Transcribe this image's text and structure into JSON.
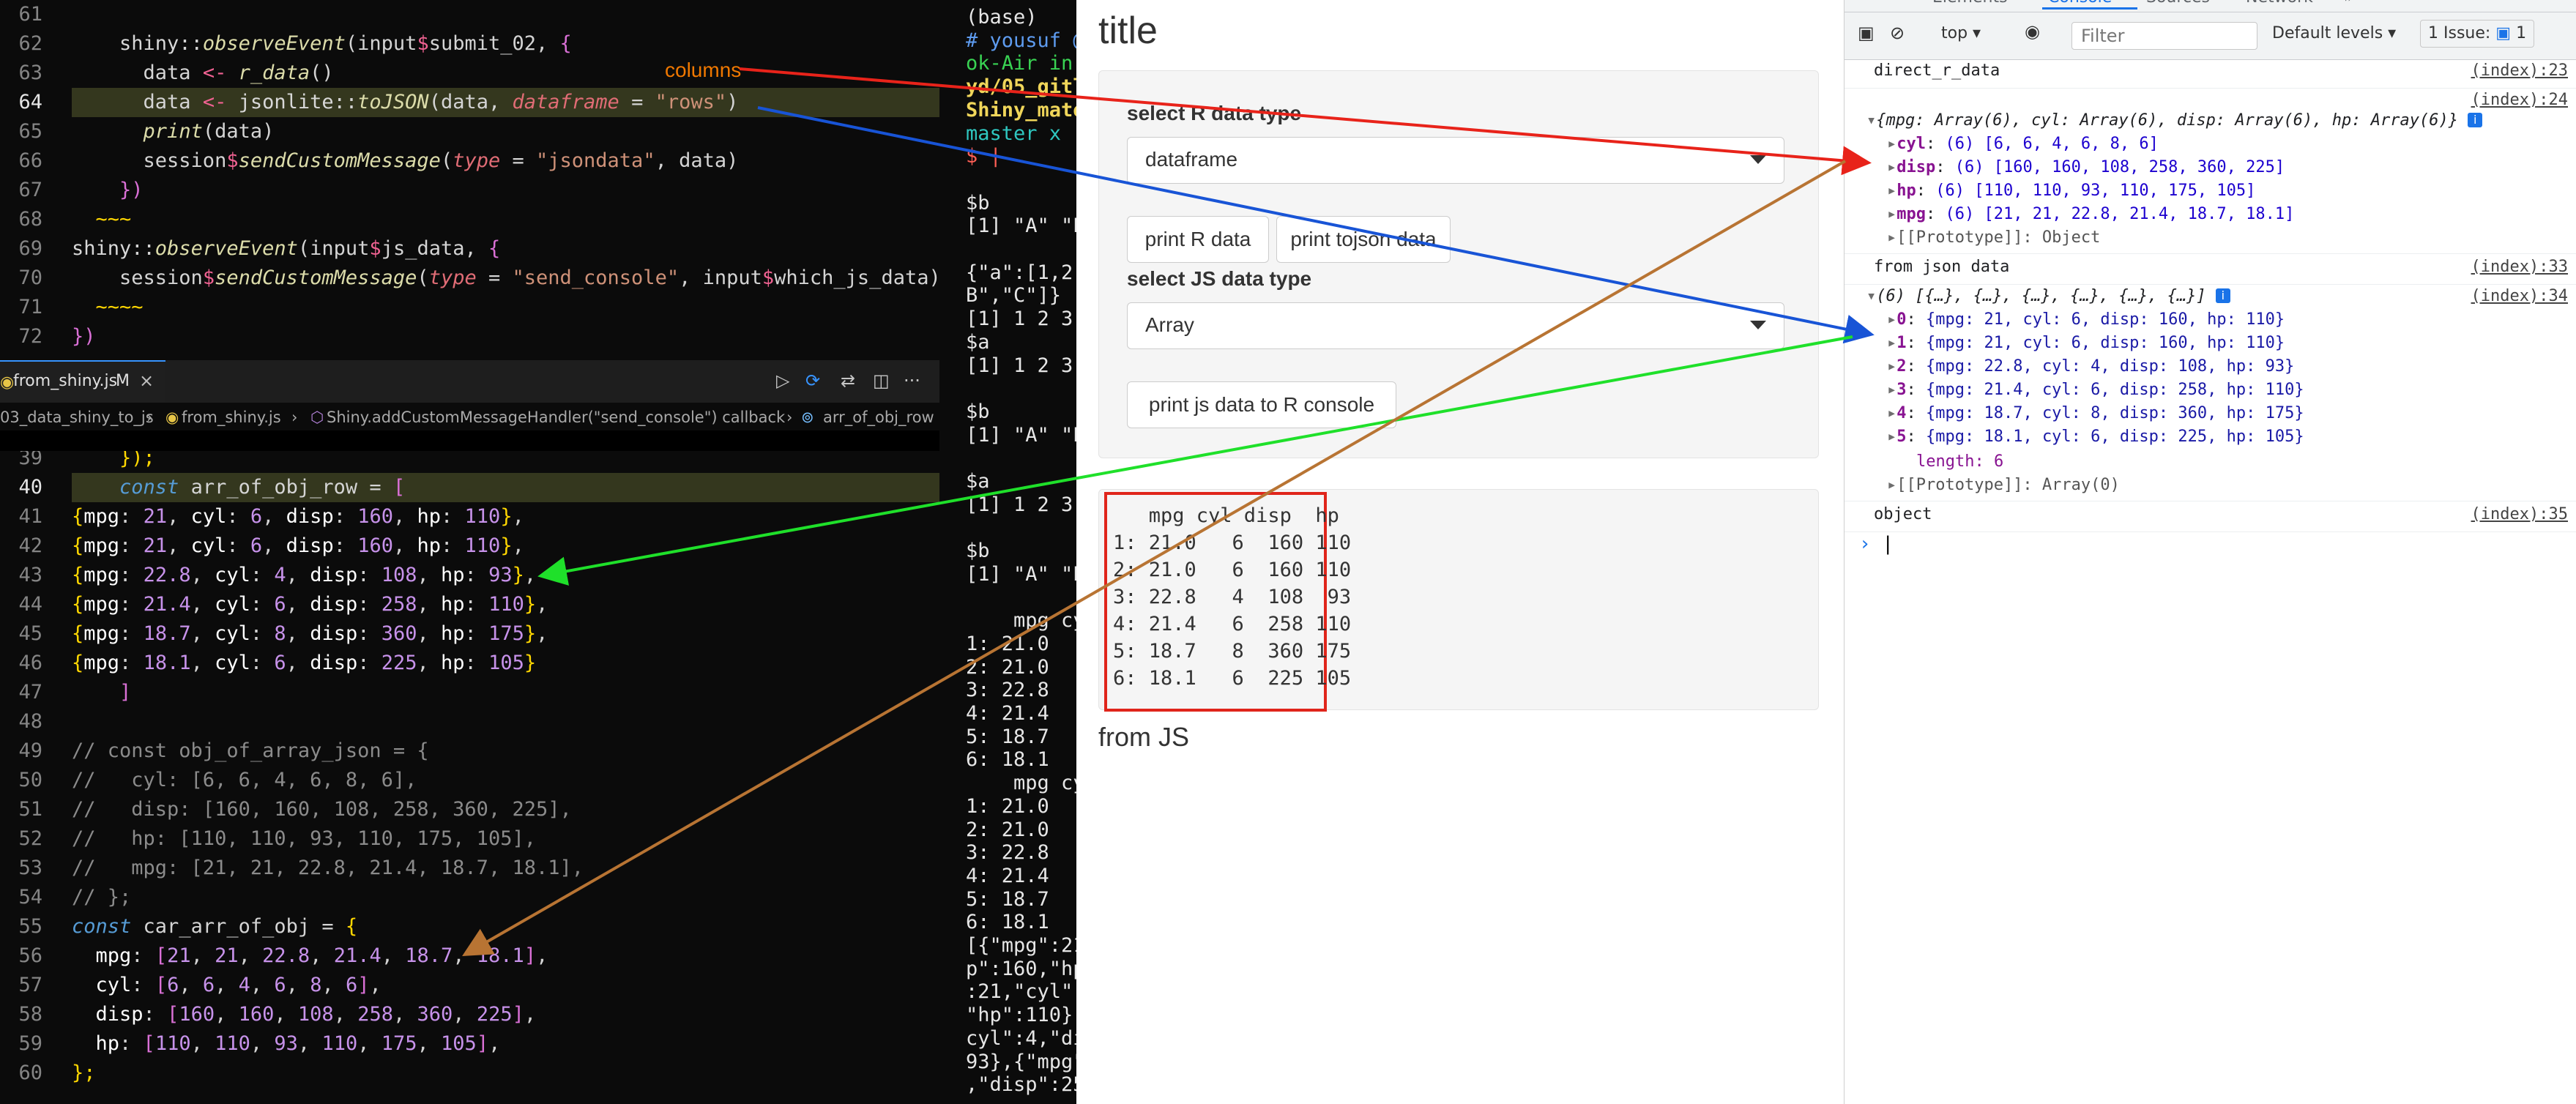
{
  "editor_top": {
    "lines": [
      {
        "num": "61",
        "html": ""
      },
      {
        "num": "62",
        "html": "    <span class='t-ns'>shiny</span><span class='t-var'>::</span><span class='t-fn'>observeEvent</span><span class='t-var'>(input</span><span class='t-dollar'>$</span><span class='t-var'>submit_02, </span><span class='t-brace2'>{</span>"
      },
      {
        "num": "63",
        "html": "      data <span class='t-op'>&lt;-</span> <span class='t-fn'>r_data</span>()"
      },
      {
        "num": "64",
        "html": "      data <span class='t-op'>&lt;-</span> <span class='t-ns'>jsonlite</span>::<span class='t-fn'>toJSON</span>(data, <span class='t-param'>dataframe</span> = <span class='t-str'>\"rows\"</span>)",
        "current": true
      },
      {
        "num": "65",
        "html": "      <span class='t-fn'>print</span>(data)"
      },
      {
        "num": "66",
        "html": "      session<span class='t-dollar'>$</span><span class='t-fn'>sendCustomMessage</span>(<span class='t-param'>type</span> = <span class='t-str'>\"jsondata\"</span>, data)"
      },
      {
        "num": "67",
        "html": "    <span class='t-brace2'>})</span>"
      },
      {
        "num": "68",
        "html": "  <span class='t-brace'>~~~</span>"
      },
      {
        "num": "69",
        "html": "<span class='t-ns'>shiny</span>::<span class='t-fn'>observeEvent</span>(input<span class='t-dollar'>$</span><span class='t-var'>js_data, </span><span class='t-brace2'>{</span>"
      },
      {
        "num": "70",
        "html": "    session<span class='t-dollar'>$</span><span class='t-fn'>sendCustomMessage</span>(<span class='t-param'>type</span> = <span class='t-str'>\"send_console\"</span>, input<span class='t-dollar'>$</span>which_js_data)"
      },
      {
        "num": "71",
        "html": "  <span class='t-brace'>~~~~</span>"
      },
      {
        "num": "72",
        "html": "<span class='t-brace2'>})</span>"
      }
    ]
  },
  "tabbar": {
    "file_name": "from_shiny.js",
    "modified": "M",
    "breadcrumb_1": "03_data_shiny_to_js",
    "breadcrumb_2": "from_shiny.js",
    "breadcrumb_3": "Shiny.addCustomMessageHandler(\"send_console\") callback",
    "breadcrumb_4": "arr_of_obj_row"
  },
  "editor_bottom": {
    "lines": [
      {
        "num": "39",
        "html": "    <span class='t-brace'>});</span>"
      },
      {
        "num": "40",
        "html": "    <span class='t-const'>const</span> <span class='t-var'>arr_of_obj_row</span> = <span class='t-brace2'>[</span>",
        "current": true
      },
      {
        "num": "41",
        "html": "<span class='t-brace'>{</span><span class='t-prop'>mpg</span>: <span class='t-num'>21</span>, <span class='t-prop'>cyl</span>: <span class='t-num'>6</span>, <span class='t-prop'>disp</span>: <span class='t-num'>160</span>, <span class='t-prop'>hp</span>: <span class='t-num'>110</span><span class='t-brace'>}</span>,"
      },
      {
        "num": "42",
        "html": "<span class='t-brace'>{</span><span class='t-prop'>mpg</span>: <span class='t-num'>21</span>, <span class='t-prop'>cyl</span>: <span class='t-num'>6</span>, <span class='t-prop'>disp</span>: <span class='t-num'>160</span>, <span class='t-prop'>hp</span>: <span class='t-num'>110</span><span class='t-brace'>}</span>,"
      },
      {
        "num": "43",
        "html": "<span class='t-brace'>{</span><span class='t-prop'>mpg</span>: <span class='t-num'>22.8</span>, <span class='t-prop'>cyl</span>: <span class='t-num'>4</span>, <span class='t-prop'>disp</span>: <span class='t-num'>108</span>, <span class='t-prop'>hp</span>: <span class='t-num'>93</span><span class='t-brace'>}</span>,"
      },
      {
        "num": "44",
        "html": "<span class='t-brace'>{</span><span class='t-prop'>mpg</span>: <span class='t-num'>21.4</span>, <span class='t-prop'>cyl</span>: <span class='t-num'>6</span>, <span class='t-prop'>disp</span>: <span class='t-num'>258</span>, <span class='t-prop'>hp</span>: <span class='t-num'>110</span><span class='t-brace'>}</span>,"
      },
      {
        "num": "45",
        "html": "<span class='t-brace'>{</span><span class='t-prop'>mpg</span>: <span class='t-num'>18.7</span>, <span class='t-prop'>cyl</span>: <span class='t-num'>8</span>, <span class='t-prop'>disp</span>: <span class='t-num'>360</span>, <span class='t-prop'>hp</span>: <span class='t-num'>175</span><span class='t-brace'>}</span>,"
      },
      {
        "num": "46",
        "html": "<span class='t-brace'>{</span><span class='t-prop'>mpg</span>: <span class='t-num'>18.1</span>, <span class='t-prop'>cyl</span>: <span class='t-num'>6</span>, <span class='t-prop'>disp</span>: <span class='t-num'>225</span>, <span class='t-prop'>hp</span>: <span class='t-num'>105</span><span class='t-brace'>}</span>"
      },
      {
        "num": "47",
        "html": "    <span class='t-brace2'>]</span>"
      },
      {
        "num": "48",
        "html": ""
      },
      {
        "num": "49",
        "html": "<span class='t-cmt2'>// const obj_of_array_json = {</span>"
      },
      {
        "num": "50",
        "html": "<span class='t-cmt2'>//   cyl: [6, 6, 4, 6, 8, 6],</span>"
      },
      {
        "num": "51",
        "html": "<span class='t-cmt2'>//   disp: [160, 160, 108, 258, 360, 225],</span>"
      },
      {
        "num": "52",
        "html": "<span class='t-cmt2'>//   hp: [110, 110, 93, 110, 175, 105],</span>"
      },
      {
        "num": "53",
        "html": "<span class='t-cmt2'>//   mpg: [21, 21, 22.8, 21.4, 18.7, 18.1],</span>"
      },
      {
        "num": "54",
        "html": "<span class='t-cmt2'>// };</span>"
      },
      {
        "num": "55",
        "html": "<span class='t-const'>const</span> <span class='t-var'>car_arr_of_obj</span> = <span class='t-brace'>{</span>"
      },
      {
        "num": "56",
        "html": "  <span class='t-prop'>mpg</span>: <span class='t-brace2'>[</span><span class='t-num'>21</span>, <span class='t-num'>21</span>, <span class='t-num'>22.8</span>, <span class='t-num'>21.4</span>, <span class='t-num'>18.7</span>, <span class='t-num'>18.1</span><span class='t-brace2'>]</span>,"
      },
      {
        "num": "57",
        "html": "  <span class='t-prop'>cyl</span>: <span class='t-brace2'>[</span><span class='t-num'>6</span>, <span class='t-num'>6</span>, <span class='t-num'>4</span>, <span class='t-num'>6</span>, <span class='t-num'>8</span>, <span class='t-num'>6</span><span class='t-brace2'>]</span>,"
      },
      {
        "num": "58",
        "html": "  <span class='t-prop'>disp</span>: <span class='t-brace2'>[</span><span class='t-num'>160</span>, <span class='t-num'>160</span>, <span class='t-num'>108</span>, <span class='t-num'>258</span>, <span class='t-num'>360</span>, <span class='t-num'>225</span><span class='t-brace2'>]</span>,"
      },
      {
        "num": "59",
        "html": "  <span class='t-prop'>hp</span>: <span class='t-brace2'>[</span><span class='t-num'>110</span>, <span class='t-num'>110</span>, <span class='t-num'>93</span>, <span class='t-num'>110</span>, <span class='t-num'>175</span>, <span class='t-num'>105</span><span class='t-brace2'>]</span>,"
      },
      {
        "num": "60",
        "html": "<span class='t-brace'>};</span>"
      }
    ]
  },
  "terminal": {
    "lines": [
      {
        "text": "(base)",
        "color": "#e6e6e6"
      },
      {
        "text": "# yousuf @",
        "color": "#5e9cf0"
      },
      {
        "text": "ok-Air in",
        "color": "#39d353"
      },
      {
        "text": "yd/05_gitl",
        "color": "#f0d65a",
        "bold": true
      },
      {
        "text": "Shiny_mate",
        "color": "#f0d65a",
        "bold": true
      },
      {
        "text": "master x",
        "color": "#2fc7c0"
      },
      {
        "text": "$ |",
        "color": "#ff5f56"
      },
      {
        "text": "",
        "color": "#e6e6e6"
      },
      {
        "text": "$b",
        "color": "#e6e6e6"
      },
      {
        "text": "[1] \"A\" \"E",
        "color": "#e6e6e6"
      },
      {
        "text": "",
        "color": "#e6e6e6"
      },
      {
        "text": "{\"a\":[1,2,",
        "color": "#e6e6e6"
      },
      {
        "text": "B\",\"C\"]}",
        "color": "#e6e6e6"
      },
      {
        "text": "[1] 1 2 3",
        "color": "#e6e6e6"
      },
      {
        "text": "$a",
        "color": "#e6e6e6"
      },
      {
        "text": "[1] 1 2 3",
        "color": "#e6e6e6"
      },
      {
        "text": "",
        "color": "#e6e6e6"
      },
      {
        "text": "$b",
        "color": "#e6e6e6"
      },
      {
        "text": "[1] \"A\" \"E",
        "color": "#e6e6e6"
      },
      {
        "text": "",
        "color": "#e6e6e6"
      },
      {
        "text": "$a",
        "color": "#e6e6e6"
      },
      {
        "text": "[1] 1 2 3",
        "color": "#e6e6e6"
      },
      {
        "text": "",
        "color": "#e6e6e6"
      },
      {
        "text": "$b",
        "color": "#e6e6e6"
      },
      {
        "text": "[1] \"A\" \"E",
        "color": "#e6e6e6"
      },
      {
        "text": "",
        "color": "#e6e6e6"
      },
      {
        "text": "    mpg cy",
        "color": "#e6e6e6"
      },
      {
        "text": "1: 21.0",
        "color": "#e6e6e6"
      },
      {
        "text": "2: 21.0",
        "color": "#e6e6e6"
      },
      {
        "text": "3: 22.8",
        "color": "#e6e6e6"
      },
      {
        "text": "4: 21.4",
        "color": "#e6e6e6"
      },
      {
        "text": "5: 18.7",
        "color": "#e6e6e6"
      },
      {
        "text": "6: 18.1",
        "color": "#e6e6e6"
      },
      {
        "text": "    mpg cy",
        "color": "#e6e6e6"
      },
      {
        "text": "1: 21.0",
        "color": "#e6e6e6"
      },
      {
        "text": "2: 21.0",
        "color": "#e6e6e6"
      },
      {
        "text": "3: 22.8",
        "color": "#e6e6e6"
      },
      {
        "text": "4: 21.4",
        "color": "#e6e6e6"
      },
      {
        "text": "5: 18.7",
        "color": "#e6e6e6"
      },
      {
        "text": "6: 18.1",
        "color": "#e6e6e6"
      },
      {
        "text": "[{\"mpg\":21",
        "color": "#e6e6e6"
      },
      {
        "text": "p\":160,\"hp",
        "color": "#e6e6e6"
      },
      {
        "text": ":21,\"cyl\"",
        "color": "#e6e6e6"
      },
      {
        "text": "\"hp\":110},",
        "color": "#e6e6e6"
      },
      {
        "text": "cyl\":4,\"di",
        "color": "#e6e6e6"
      },
      {
        "text": "93},{\"mpg\"",
        "color": "#e6e6e6"
      },
      {
        "text": ",\"disp\":25",
        "color": "#e6e6e6"
      }
    ]
  },
  "shiny": {
    "title": "title",
    "r_type_label": "select R data type",
    "r_type_value": "dataframe",
    "print_r_label": "print R data",
    "print_tojson_label": "print tojson data",
    "js_type_label": "select JS data type",
    "js_type_value": "Array",
    "print_js_label": "print js data to R console",
    "table_lines": [
      "   mpg cyl disp  hp",
      "1: 21.0   6  160 110",
      "2: 21.0   6  160 110",
      "3: 22.8   4  108  93",
      "4: 21.4   6  258 110",
      "5: 18.7   8  360 175",
      "6: 18.1   6  225 105"
    ],
    "from_js": "from JS"
  },
  "devtools": {
    "tabs": [
      "Elements",
      "Console",
      "Sources",
      "Network",
      "»"
    ],
    "context": "top",
    "filter_placeholder": "Filter",
    "levels": "Default levels",
    "issues": "1 Issue:",
    "issue_count": "1",
    "console": {
      "direct_r_data": "direct_r_data",
      "src_23": "(index):23",
      "src_24": "(index):24",
      "obj_summary": "{mpg: Array(6), cyl: Array(6), disp: Array(6), hp: Array(6)}",
      "obj_props": [
        {
          "key": "cyl",
          "val": "(6) [6, 6, 4, 6, 8, 6]"
        },
        {
          "key": "disp",
          "val": "(6) [160, 160, 108, 258, 360, 225]"
        },
        {
          "key": "hp",
          "val": "(6) [110, 110, 93, 110, 175, 105]"
        },
        {
          "key": "mpg",
          "val": "(6) [21, 21, 22.8, 21.4, 18.7, 18.1]"
        }
      ],
      "proto_object": "[[Prototype]]: Object",
      "from_json": "from json data",
      "src_33": "(index):33",
      "src_34": "(index):34",
      "arr_summary": "(6) [{…}, {…}, {…}, {…}, {…}, {…}]",
      "arr_items": [
        {
          "idx": "0",
          "val": "{mpg: 21, cyl: 6, disp: 160, hp: 110}"
        },
        {
          "idx": "1",
          "val": "{mpg: 21, cyl: 6, disp: 160, hp: 110}"
        },
        {
          "idx": "2",
          "val": "{mpg: 22.8, cyl: 4, disp: 108, hp: 93}"
        },
        {
          "idx": "3",
          "val": "{mpg: 21.4, cyl: 6, disp: 258, hp: 110}"
        },
        {
          "idx": "4",
          "val": "{mpg: 18.7, cyl: 8, disp: 360, hp: 175}"
        },
        {
          "idx": "5",
          "val": "{mpg: 18.1, cyl: 6, disp: 225, hp: 105}"
        }
      ],
      "length": "length: 6",
      "proto_array": "[[Prototype]]: Array(0)",
      "object_text": "object",
      "src_35": "(index):35",
      "prompt": "›"
    }
  },
  "annotations": {
    "columns_note": "columns",
    "arrow_colors": {
      "red": "#e8231a",
      "blue": "#1854d6",
      "green": "#1fe02a",
      "brown": "#b87433"
    }
  }
}
